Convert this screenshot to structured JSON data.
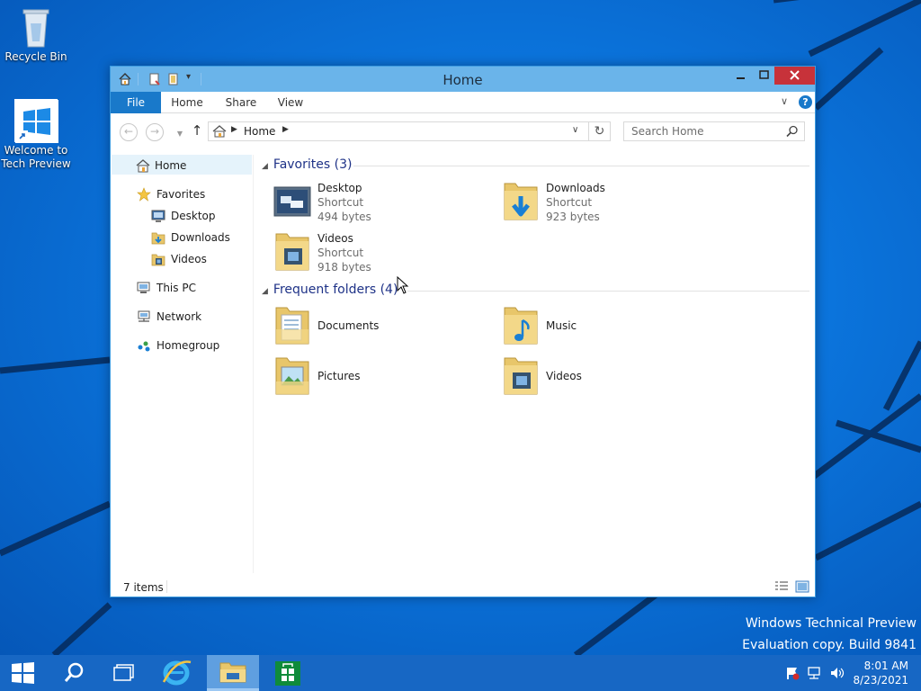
{
  "desktop": {
    "icons": [
      {
        "label": "Recycle Bin"
      },
      {
        "label_line1": "Welcome to",
        "label_line2": "Tech Preview"
      }
    ],
    "watermark_line1": "Windows Technical Preview",
    "watermark_line2": "Evaluation copy. Build 9841"
  },
  "window": {
    "title": "Home",
    "ribbon_tabs": {
      "file": "File",
      "home": "Home",
      "share": "Share",
      "view": "View"
    },
    "help_label": "?",
    "address": {
      "location": "Home"
    },
    "search": {
      "placeholder": "Search Home"
    },
    "nav_pane": {
      "home": "Home",
      "favorites": "Favorites",
      "desktop": "Desktop",
      "downloads": "Downloads",
      "videos": "Videos",
      "this_pc": "This PC",
      "network": "Network",
      "homegroup": "Homegroup"
    },
    "favorites_group": {
      "header": "Favorites (3)",
      "items": [
        {
          "name": "Desktop",
          "type": "Shortcut",
          "size": "494 bytes"
        },
        {
          "name": "Downloads",
          "type": "Shortcut",
          "size": "923 bytes"
        },
        {
          "name": "Videos",
          "type": "Shortcut",
          "size": "918 bytes"
        }
      ]
    },
    "frequent_group": {
      "header": "Frequent folders (4)",
      "items": [
        {
          "name": "Documents"
        },
        {
          "name": "Music"
        },
        {
          "name": "Pictures"
        },
        {
          "name": "Videos"
        }
      ]
    },
    "status": "7 items"
  },
  "taskbar": {
    "time": "8:01 AM",
    "date": "8/23/2021",
    "accent": "#1767c4"
  }
}
